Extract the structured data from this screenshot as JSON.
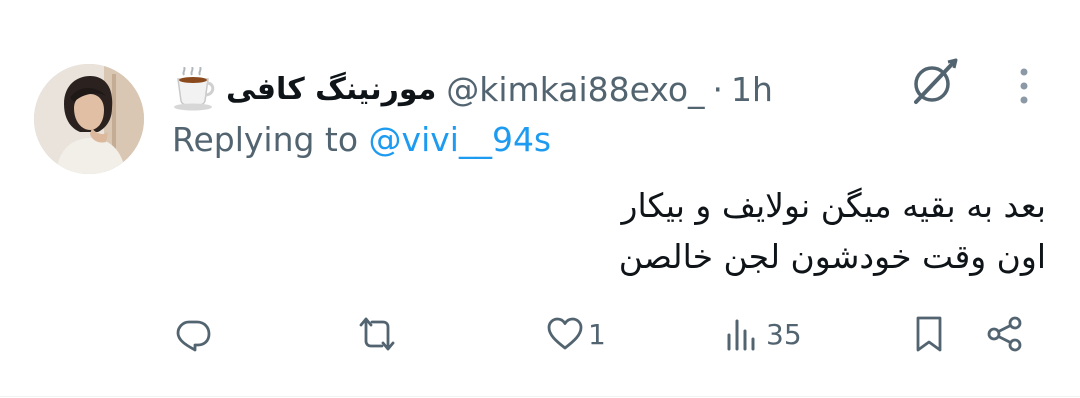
{
  "tweet": {
    "display_name": "مورنینگ کافی",
    "handle": "@kimkai88exo_",
    "separator": "·",
    "time": "1h",
    "replying_prefix": "Replying to",
    "replying_mention": "@vivi__94s",
    "body_lines": [
      "بعد به بقیه میگن نولایف و بیکار",
      "اون وقت خودشون لجن خالصن"
    ],
    "name_emoji": "coffee-icon",
    "colors": {
      "accent": "#1d9bf0",
      "secondary_text": "#536471",
      "primary_text": "#0f1419"
    }
  },
  "actions": {
    "reply_count": "",
    "retweet_count": "",
    "like_count": "1",
    "views_count": "35"
  }
}
